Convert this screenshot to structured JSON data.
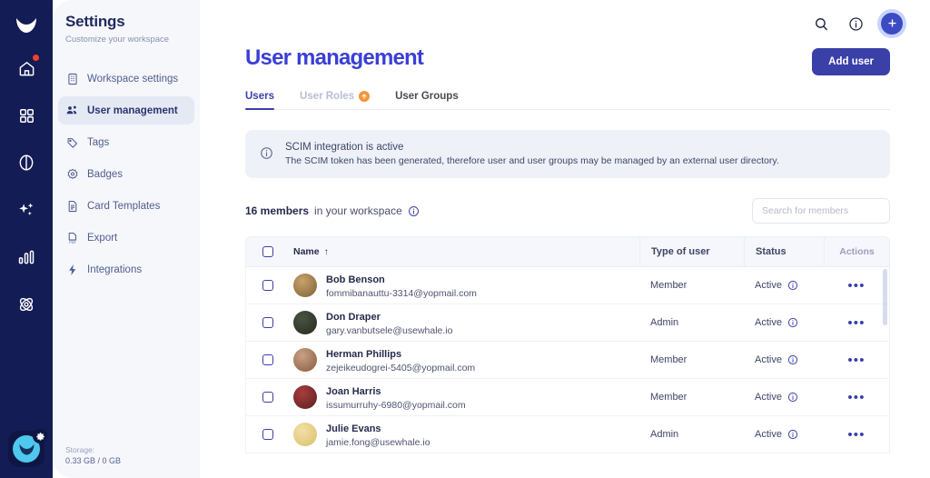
{
  "rail": {
    "logo_icon": "whale-logo-icon",
    "items": [
      {
        "icon": "home-icon",
        "name": "home",
        "badge": true
      },
      {
        "icon": "grid-apps-icon",
        "name": "apps",
        "badge": false
      },
      {
        "icon": "brain-icon",
        "name": "knowledge",
        "badge": false
      },
      {
        "icon": "sparkles-icon",
        "name": "ai-assistant",
        "badge": false
      },
      {
        "icon": "bar-chart-icon",
        "name": "analytics",
        "badge": false
      },
      {
        "icon": "atom-icon",
        "name": "integrations",
        "badge": false
      }
    ],
    "account_icon": "user-avatar-icon",
    "account_gear_icon": "gear-icon"
  },
  "sidebar": {
    "title": "Settings",
    "subtitle": "Customize your workspace",
    "items": [
      {
        "label": "Workspace settings",
        "icon": "building-icon",
        "active": false
      },
      {
        "label": "User management",
        "icon": "users-icon",
        "active": true
      },
      {
        "label": "Tags",
        "icon": "tag-icon",
        "active": false
      },
      {
        "label": "Badges",
        "icon": "badge-icon",
        "active": false
      },
      {
        "label": "Card Templates",
        "icon": "document-icon",
        "active": false
      },
      {
        "label": "Export",
        "icon": "pdf-export-icon",
        "active": false
      },
      {
        "label": "Integrations",
        "icon": "lightning-icon",
        "active": false
      }
    ],
    "storage_label": "Storage:",
    "storage_value": "0.33 GB / 0 GB"
  },
  "topbar": {
    "search_icon": "search-icon",
    "info_icon": "info-circle-icon",
    "plus_icon": "plus-icon",
    "add_user_label": "Add user"
  },
  "page": {
    "title": "User management"
  },
  "tabs": [
    {
      "label": "Users",
      "active": true,
      "disabled": false,
      "badge": null
    },
    {
      "label": "User Roles",
      "active": false,
      "disabled": true,
      "badge": "upgrade-arrow-icon"
    },
    {
      "label": "User Groups",
      "active": false,
      "disabled": false,
      "badge": null
    }
  ],
  "notice": {
    "icon": "info-circle-icon",
    "title": "SCIM integration is active",
    "body": "The SCIM token has been generated, therefore user and user groups may be managed by an external user directory."
  },
  "meta": {
    "count_text": "16 members",
    "count_suffix": "in your workspace",
    "info_icon": "info-circle-icon"
  },
  "search": {
    "placeholder": "Search for members",
    "value": ""
  },
  "table": {
    "headers": {
      "name": "Name",
      "sort_icon": "arrow-up-icon",
      "type": "Type of user",
      "status": "Status",
      "actions": "Actions"
    },
    "rows": [
      {
        "name": "Bob Benson",
        "email": "fommibanauttu-3314@yopmail.com",
        "type": "Member",
        "status": "Active",
        "avatar_colors": [
          "#c9a26b",
          "#7e6038"
        ],
        "checked": false
      },
      {
        "name": "Don Draper",
        "email": "gary.vanbutsele@usewhale.io",
        "type": "Admin",
        "status": "Active",
        "avatar_colors": [
          "#4a5340",
          "#252a1c"
        ],
        "checked": false
      },
      {
        "name": "Herman Phillips",
        "email": "zejeikeudogrei-5405@yopmail.com",
        "type": "Member",
        "status": "Active",
        "avatar_colors": [
          "#c7a287",
          "#8a5a3a"
        ],
        "checked": false
      },
      {
        "name": "Joan Harris",
        "email": "issumurruhy-6980@yopmail.com",
        "type": "Member",
        "status": "Active",
        "avatar_colors": [
          "#a83d3d",
          "#5c1f20"
        ],
        "checked": false
      },
      {
        "name": "Julie Evans",
        "email": "jamie.fong@usewhale.io",
        "type": "Admin",
        "status": "Active",
        "avatar_colors": [
          "#f3dfa8",
          "#d9c06a"
        ],
        "checked": false
      }
    ],
    "row_status_info_icon": "info-circle-icon",
    "row_actions_icon": "more-horizontal-icon"
  },
  "colors": {
    "rail_bg": "#131c54",
    "sidebar_bg": "#f5f7fb",
    "accent": "#3b3fa8",
    "title_blue": "#3b3fd6",
    "badge_orange": "#f59337",
    "notice_bg": "#eef1f8",
    "alert_dot": "#f5402c"
  }
}
